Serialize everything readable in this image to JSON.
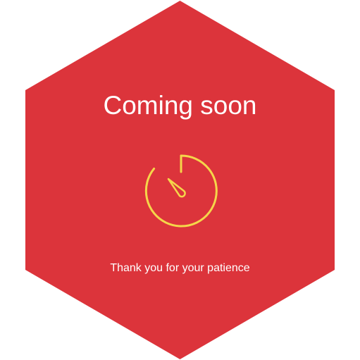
{
  "heading": "Coming soon",
  "message": "Thank you for your patience",
  "icons": {
    "timer": "stopwatch-icon"
  },
  "colors": {
    "background": "#ffffff",
    "hexagon": "#dc343b",
    "text": "#ffffff",
    "icon": "#f5d64a"
  }
}
